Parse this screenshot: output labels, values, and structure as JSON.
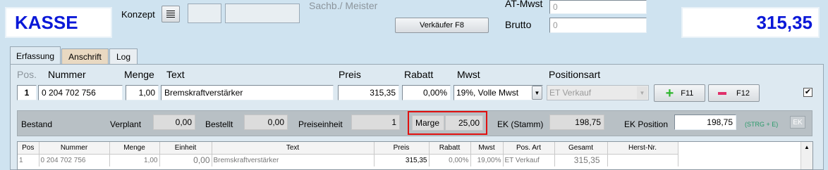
{
  "header": {
    "kasse_label": "KASSE",
    "konzept_label": "Konzept",
    "sachb_label": "Sachb./ Meister",
    "verkaeufer_button": "Verkäufer F8",
    "at_mwst_label": "AT-Mwst",
    "at_mwst_value": "0",
    "brutto_label": "Brutto",
    "brutto_value": "0",
    "total": "315,35"
  },
  "tabs": [
    {
      "label": "Erfassung",
      "active": true
    },
    {
      "label": "Anschrift",
      "active": false
    },
    {
      "label": "Log",
      "active": false
    }
  ],
  "entry": {
    "headers": {
      "pos": "Pos.",
      "nummer": "Nummer",
      "menge": "Menge",
      "text": "Text",
      "preis": "Preis",
      "rabatt": "Rabatt",
      "mwst": "Mwst",
      "positionsart": "Positionsart"
    },
    "pos": "1",
    "nummer": "0 204 702 756",
    "menge": "1,00",
    "text": "Bremskraftverstärker",
    "preis": "315,35",
    "rabatt": "0,00%",
    "mwst": "19%, Volle Mwst",
    "positionsart": "ET Verkauf",
    "add_button": "F11",
    "remove_button": "F12",
    "checkbox_checked": true
  },
  "bestand": {
    "bestand_label": "Bestand",
    "verplant_label": "Verplant",
    "verplant_value": "0,00",
    "bestellt_label": "Bestellt",
    "bestellt_value": "0,00",
    "preiseinheit_label": "Preiseinheit",
    "preiseinheit_value": "1",
    "marge_label": "Marge",
    "marge_value": "25,00",
    "ek_stamm_label": "EK (Stamm)",
    "ek_stamm_value": "198,75",
    "ek_position_label": "EK Position",
    "ek_position_value": "198,75",
    "shortcut_hint": "(STRG + E)",
    "ek_button": "EK"
  },
  "table": {
    "columns": [
      "Pos",
      "Nummer",
      "Menge",
      "Einheit",
      "Text",
      "Preis",
      "Rabatt",
      "Mwst",
      "Pos. Art",
      "Gesamt",
      "Herst-Nr."
    ],
    "rows": [
      [
        "1",
        "0 204 702 756",
        "1,00",
        "0,00",
        "Bremskraftverstärker",
        "315,35",
        "0,00%",
        "19,00%",
        "ET Verkauf",
        "315,35",
        ""
      ]
    ]
  },
  "colors": {
    "kasse_text": "#0a18d8",
    "total_text": "#0a18d8",
    "background": "#cfe3f0",
    "marge_highlight": "#e01010",
    "plus_icon": "#2db52d",
    "minus_icon": "#e0306a"
  }
}
